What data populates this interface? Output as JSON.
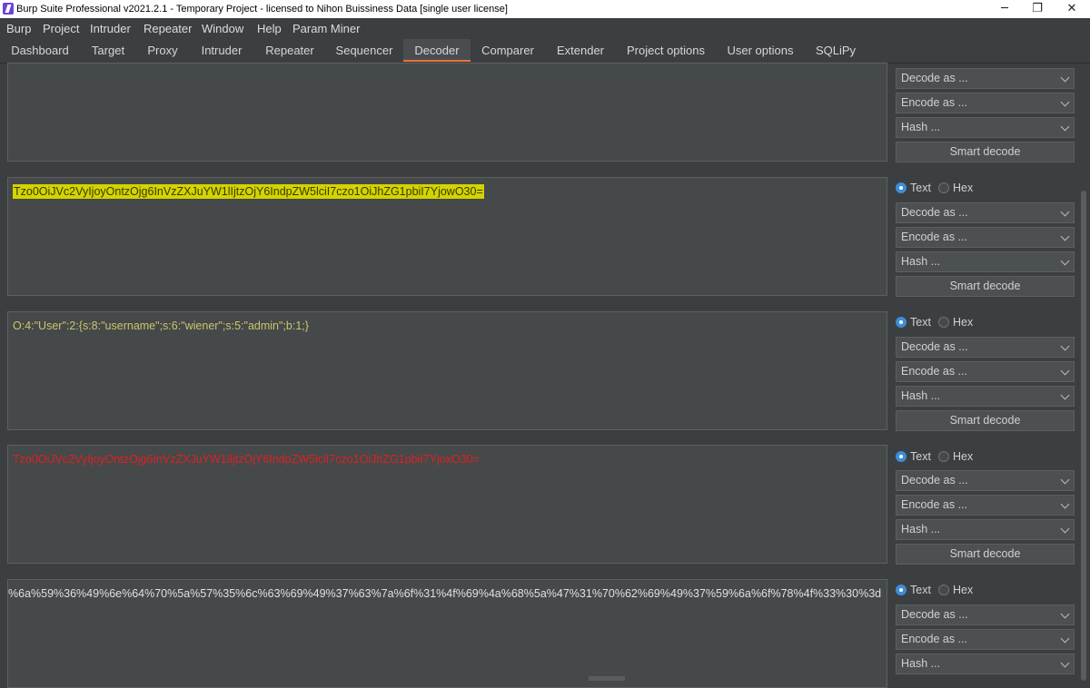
{
  "window": {
    "title": "Burp Suite Professional v2021.2.1 - Temporary Project - licensed to Nihon Buissiness Data [single user license]",
    "minimize": "─",
    "restore": "❐",
    "close": "✕"
  },
  "menu": [
    "Burp",
    "Project",
    "Intruder",
    "Repeater",
    "Window",
    "Help",
    "Param Miner"
  ],
  "tabs": [
    "Dashboard",
    "Target",
    "Proxy",
    "Intruder",
    "Repeater",
    "Sequencer",
    "Decoder",
    "Comparer",
    "Extender",
    "Project options",
    "User options",
    "SQLiPy"
  ],
  "active_tab": "Decoder",
  "controls": {
    "text": "Text",
    "hex": "Hex",
    "decode_as": "Decode as ...",
    "encode_as": "Encode as ...",
    "hash": "Hash ...",
    "smart_decode": "Smart decode"
  },
  "panels": [
    {
      "text": ""
    },
    {
      "text": "Tzo0OiJVc2VyIjoyOntzOjg6InVzZXJuYW1lIjtzOjY6IndpZW5lciI7czo1OiJhZG1pbiI7YjowO30="
    },
    {
      "text": "O:4:\"User\":2:{s:8:\"username\";s:6:\"wiener\";s:5:\"admin\";b:1;}"
    },
    {
      "text": "Tzo0OiJVc2VyIjoyOntzOjg6InVzZXJuYW1lIjtzOjY6IndpZW5lciI7czo1OiJhZG1pbiI7YjoxO30="
    },
    {
      "text": "%6a%59%36%49%6e%64%70%5a%57%35%6c%63%69%49%37%63%7a%6f%31%4f%69%4a%68%5a%47%31%70%62%69%49%37%59%6a%6f%78%4f%33%30%3d"
    }
  ],
  "colors": {
    "highlight": "#d4d400",
    "decoded_text": "#cbc66a",
    "modified_text": "#e02020",
    "accent_tab": "#e8733b",
    "radio_selected": "#3d8dd8"
  }
}
